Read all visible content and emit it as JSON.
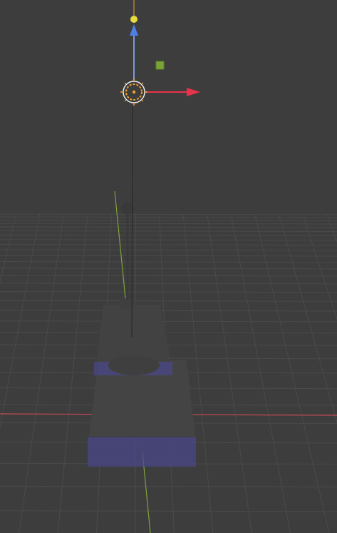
{
  "viewport": {
    "kind": "3d-viewport",
    "background_color": "#3d3d3d",
    "grid_color": "#4a4a4a",
    "x_axis_color": "#c44a53",
    "y_axis_color": "#7fa33a"
  },
  "gizmo": {
    "kind": "transform-gizmo",
    "x_arrow_color": "#e8334a",
    "z_arrow_color": "#4f7ee8",
    "z_handle_color": "#e8c33a",
    "free_move_handle_color": "#79a33a",
    "pivot_color": "#f0a030"
  },
  "scene_objects": [
    {
      "name": "pedestal-base",
      "color": "#444444",
      "overlay": "#4a4787"
    },
    {
      "name": "pedestal-top",
      "color": "#424242",
      "overlay": "#4a4787"
    },
    {
      "name": "lamp-stand",
      "color": "#3f3f3f"
    }
  ]
}
